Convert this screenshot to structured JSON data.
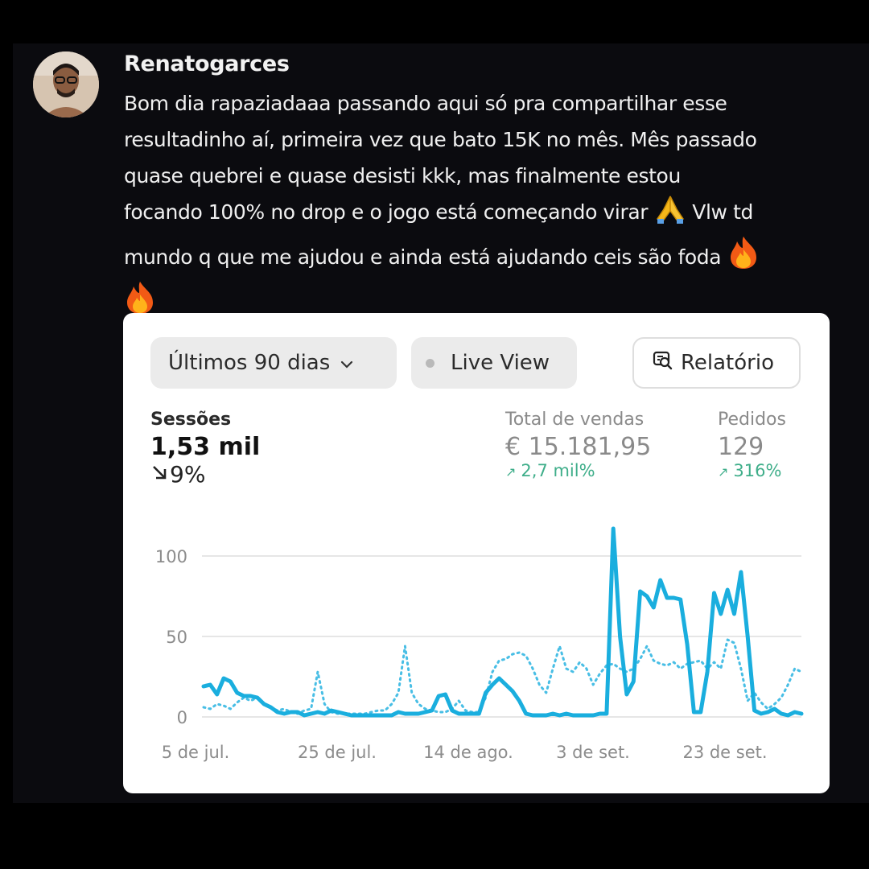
{
  "post": {
    "username": "Renatogarces",
    "message_lines": [
      "Bom dia rapaziadaaa passando aqui só pra compartilhar esse",
      "resultadinho aí, primeira vez que bato 15K no mês. Mês passado",
      "quase quebrei e quase desisti kkk, mas finalmente estou",
      "focando 100% no drop e o jogo está começando virar",
      "Vlw td",
      "mundo q que me ajudou e ainda está ajudando ceis são foda"
    ],
    "emojis": [
      "folded-hands",
      "fire",
      "fire"
    ]
  },
  "dashboard": {
    "period_button": "Últimos 90 dias",
    "live_button": "Live View",
    "report_button": "Relatório",
    "metrics": [
      {
        "label": "Sessões",
        "value": "1,53 mil",
        "change": "9%",
        "direction": "down"
      },
      {
        "label": "Total de vendas",
        "value": "€ 15.181,95",
        "change": "2,7 mil%",
        "direction": "up"
      },
      {
        "label": "Pedidos",
        "value": "129",
        "change": "316%",
        "direction": "up"
      }
    ],
    "colors": {
      "accent": "#1aaede",
      "positive": "#3fae8a"
    }
  },
  "chart_data": {
    "type": "line",
    "ylim": [
      0,
      120
    ],
    "yticks": [
      "0",
      "50",
      "100"
    ],
    "ytick_values": [
      0,
      50,
      100
    ],
    "xticks": [
      "5 de jul.",
      "25 de jul.",
      "14 de ago.",
      "3 de set.",
      "23 de set."
    ],
    "grid": true,
    "series": [
      {
        "style": "solid",
        "x": [
          0,
          1,
          2,
          3,
          4,
          5,
          6,
          7,
          8,
          9,
          10,
          11,
          12,
          13,
          14,
          15,
          16,
          17,
          18,
          19,
          20,
          21,
          22,
          23,
          24,
          25,
          26,
          27,
          28,
          29,
          30,
          31,
          32,
          33,
          34,
          35,
          36,
          37,
          38,
          39,
          40,
          41,
          42,
          43,
          44,
          45,
          46,
          47,
          48,
          49,
          50,
          51,
          52,
          53,
          54,
          55,
          56,
          57,
          58,
          59,
          60,
          61,
          62,
          63,
          64,
          65,
          66,
          67,
          68,
          69,
          70,
          71,
          72,
          73,
          74,
          75,
          76,
          77,
          78,
          79,
          80,
          81,
          82,
          83,
          84,
          85,
          86,
          87,
          88,
          89
        ],
        "values": [
          19,
          20,
          14,
          24,
          22,
          15,
          13,
          13,
          12,
          8,
          6,
          3,
          2,
          3,
          3,
          1,
          2,
          3,
          2,
          4,
          3,
          2,
          1,
          1,
          1,
          1,
          1,
          1,
          1,
          3,
          2,
          2,
          2,
          3,
          4,
          13,
          14,
          4,
          2,
          2,
          2,
          2,
          15,
          20,
          24,
          20,
          16,
          10,
          2,
          1,
          1,
          1,
          2,
          1,
          2,
          1,
          1,
          1,
          1,
          2,
          2,
          117,
          50,
          14,
          22,
          78,
          75,
          68,
          85,
          74,
          74,
          73,
          45,
          3,
          3,
          28,
          77,
          64,
          79,
          64,
          90,
          50,
          4,
          2,
          3,
          5,
          2,
          1,
          3,
          2
        ]
      },
      {
        "style": "dotted",
        "x": [
          0,
          1,
          2,
          3,
          4,
          5,
          6,
          7,
          8,
          9,
          10,
          11,
          12,
          13,
          14,
          15,
          16,
          17,
          18,
          19,
          20,
          21,
          22,
          23,
          24,
          25,
          26,
          27,
          28,
          29,
          30,
          31,
          32,
          33,
          34,
          35,
          36,
          37,
          38,
          39,
          40,
          41,
          42,
          43,
          44,
          45,
          46,
          47,
          48,
          49,
          50,
          51,
          52,
          53,
          54,
          55,
          56,
          57,
          58,
          59,
          60,
          61,
          62,
          63,
          64,
          65,
          66,
          67,
          68,
          69,
          70,
          71,
          72,
          73,
          74,
          75,
          76,
          77,
          78,
          79,
          80,
          81,
          82,
          83,
          84,
          85,
          86,
          87,
          88,
          89
        ],
        "values": [
          6,
          5,
          8,
          7,
          5,
          9,
          12,
          10,
          12,
          8,
          6,
          4,
          5,
          3,
          2,
          4,
          5,
          28,
          8,
          3,
          2,
          2,
          2,
          2,
          2,
          3,
          4,
          4,
          8,
          15,
          44,
          15,
          8,
          5,
          4,
          3,
          3,
          5,
          10,
          4,
          3,
          3,
          12,
          28,
          35,
          36,
          39,
          40,
          38,
          30,
          20,
          15,
          30,
          44,
          30,
          28,
          34,
          30,
          20,
          27,
          32,
          33,
          30,
          28,
          30,
          36,
          44,
          35,
          33,
          32,
          34,
          30,
          33,
          34,
          35,
          30,
          34,
          30,
          48,
          46,
          30,
          10,
          15,
          9,
          5,
          8,
          12,
          20,
          30,
          28
        ]
      }
    ]
  }
}
